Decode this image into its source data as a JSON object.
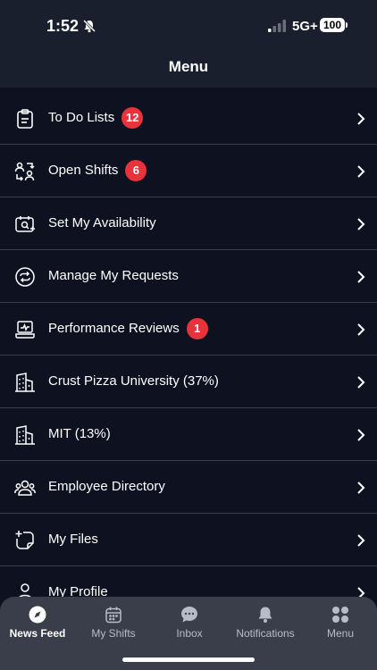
{
  "status_bar": {
    "time": "1:52",
    "network": "5G+",
    "battery": "100"
  },
  "header": {
    "title": "Menu"
  },
  "menu": [
    {
      "label": "To Do Lists",
      "badge": "12",
      "icon": "clipboard-icon"
    },
    {
      "label": "Open Shifts",
      "badge": "6",
      "icon": "swap-users-icon"
    },
    {
      "label": "Set My Availability",
      "badge": null,
      "icon": "calendar-availability-icon"
    },
    {
      "label": "Manage My Requests",
      "badge": null,
      "icon": "refresh-circle-icon"
    },
    {
      "label": "Performance Reviews",
      "badge": "1",
      "icon": "laptop-chart-icon"
    },
    {
      "label": "Crust Pizza University (37%)",
      "badge": null,
      "icon": "building-icon"
    },
    {
      "label": "MIT (13%)",
      "badge": null,
      "icon": "building-icon"
    },
    {
      "label": "Employee Directory",
      "badge": null,
      "icon": "users-icon"
    },
    {
      "label": "My Files",
      "badge": null,
      "icon": "file-add-icon"
    },
    {
      "label": "My Profile",
      "badge": null,
      "icon": "user-icon"
    }
  ],
  "tabs": [
    {
      "label": "News Feed",
      "icon": "compass-icon",
      "active": true
    },
    {
      "label": "My Shifts",
      "icon": "calendar-icon",
      "active": false
    },
    {
      "label": "Inbox",
      "icon": "chat-icon",
      "active": false
    },
    {
      "label": "Notifications",
      "icon": "bell-icon",
      "active": false
    },
    {
      "label": "Menu",
      "icon": "grid-icon",
      "active": false
    }
  ],
  "colors": {
    "background": "#0e1220",
    "header": "#1a1f2e",
    "badge": "#e8323c",
    "tab_bar": "#3a3e4a"
  }
}
